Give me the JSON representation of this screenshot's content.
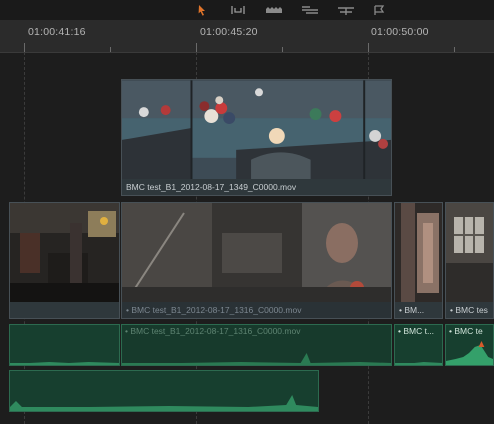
{
  "toolbar": {
    "tools": [
      {
        "name": "selection-tool-icon"
      },
      {
        "name": "trim-tool-icon"
      },
      {
        "name": "blade-tool-icon"
      },
      {
        "name": "snapping-icon"
      },
      {
        "name": "linked-selection-icon"
      },
      {
        "name": "flag-icon"
      }
    ]
  },
  "ruler": {
    "timecodes": [
      "01:00:41:16",
      "01:00:45:20",
      "01:00:50:00"
    ]
  },
  "timeline": {
    "video_track_2": {
      "clip": {
        "label": "BMC test_B1_2012-08-17_1349_C0000.mov"
      }
    },
    "video_track_1": {
      "clips": [
        {
          "label": ""
        },
        {
          "label": "• BMC test_B1_2012-08-17_1316_C0000.mov"
        },
        {
          "label": "• BM..."
        },
        {
          "label": "• BMC tes"
        }
      ]
    },
    "audio_track_1": {
      "clips": [
        {
          "label": ""
        },
        {
          "label": "• BMC test_B1_2012-08-17_1316_C0000.mov"
        },
        {
          "label": "• BMC t..."
        },
        {
          "label": "• BMC te"
        }
      ]
    },
    "audio_track_2": {
      "clips": [
        {
          "label": ""
        }
      ]
    }
  },
  "colors": {
    "accent_audio": "#1f5a43",
    "video_clip": "#2a3438",
    "playhead_orange": "#e0742a"
  }
}
